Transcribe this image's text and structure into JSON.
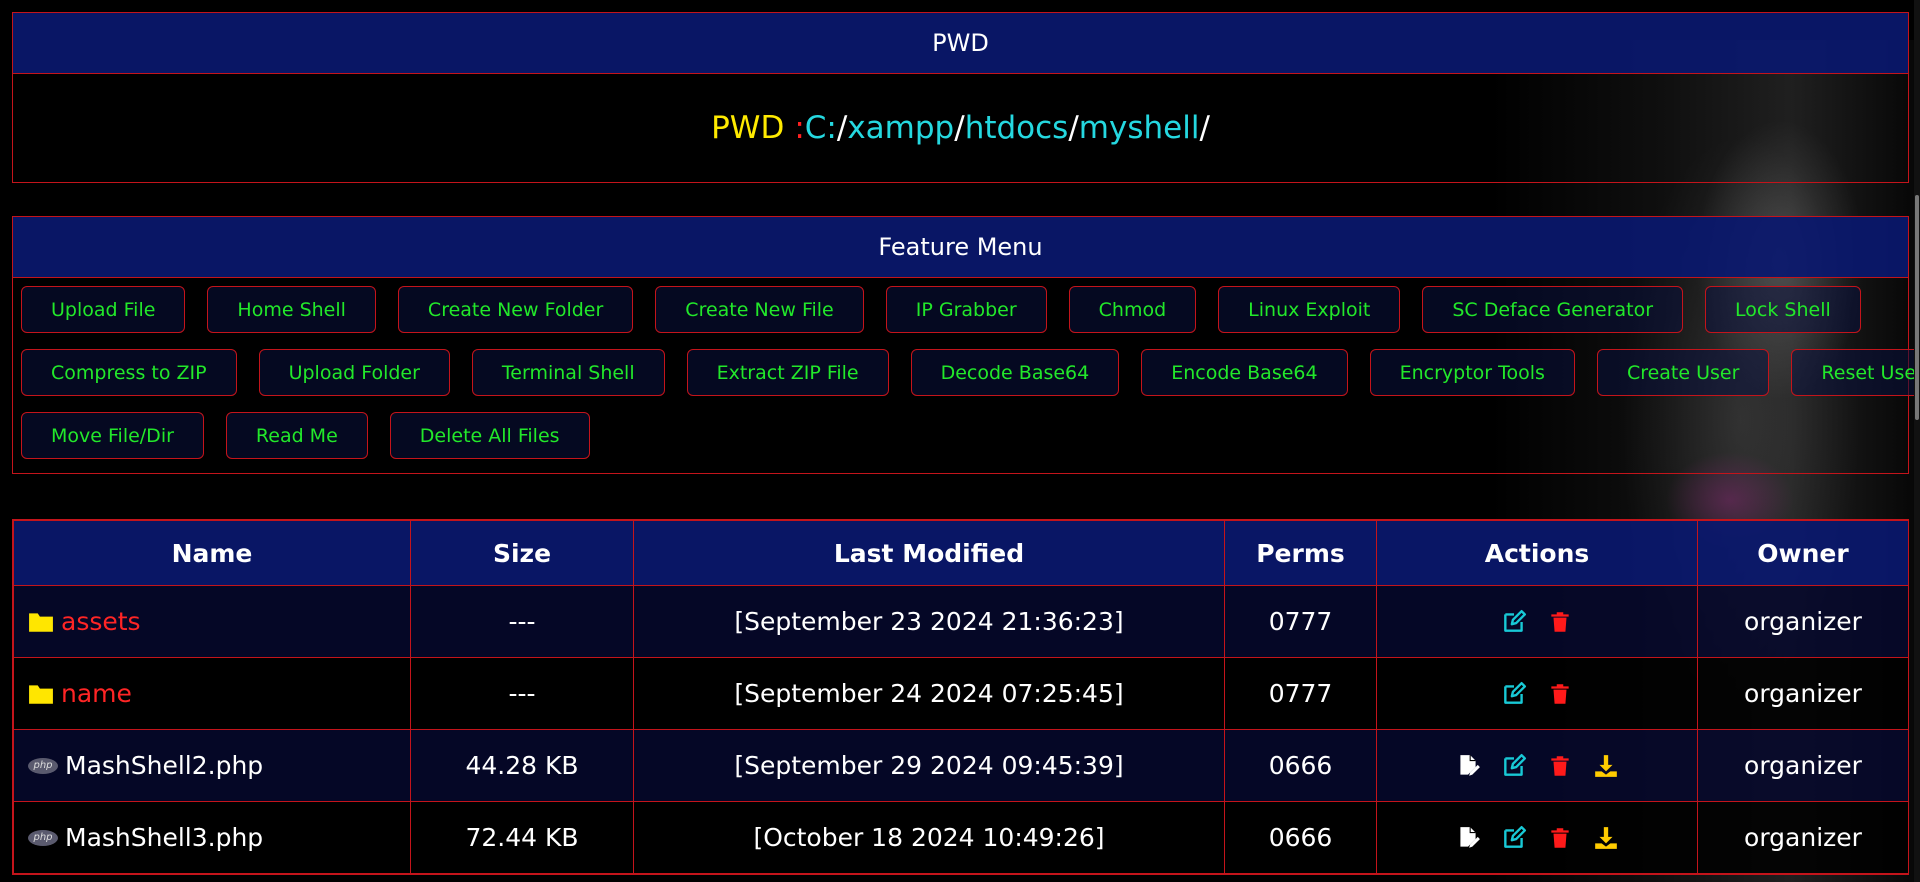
{
  "pwd_panel": {
    "title": "PWD",
    "label": "PWD",
    "colon": ":",
    "segments": [
      "C:",
      "xampp",
      "htdocs",
      "myshell"
    ],
    "separator": "/"
  },
  "feature_menu": {
    "title": "Feature Menu",
    "rows": [
      [
        "Upload File",
        "Home Shell",
        "Create New Folder",
        "Create New File",
        "IP Grabber",
        "Chmod",
        "Linux Exploit",
        "SC Deface Generator",
        "Lock Shell"
      ],
      [
        "Compress to ZIP",
        "Upload Folder",
        "Terminal Shell",
        "Extract ZIP File",
        "Decode Base64",
        "Encode Base64",
        "Encryptor Tools",
        "Create User",
        "Reset Users"
      ],
      [
        "Move File/Dir",
        "Read Me",
        "Delete All Files"
      ]
    ]
  },
  "file_table": {
    "headers": [
      "Name",
      "Size",
      "Last Modified",
      "Perms",
      "Actions",
      "Owner"
    ],
    "rows": [
      {
        "type": "folder",
        "name": "assets",
        "size": "---",
        "modified": "[September 23 2024 21:36:23]",
        "perms": "0777",
        "owner": "organizer"
      },
      {
        "type": "folder",
        "name": "name",
        "size": "---",
        "modified": "[September 24 2024 07:25:45]",
        "perms": "0777",
        "owner": "organizer"
      },
      {
        "type": "php",
        "name": "MashShell2.php",
        "size": "44.28 KB",
        "modified": "[September 29 2024 09:45:39]",
        "perms": "0666",
        "owner": "organizer"
      },
      {
        "type": "php",
        "name": "MashShell3.php",
        "size": "72.44 KB",
        "modified": "[October 18 2024 10:49:26]",
        "perms": "0666",
        "owner": "organizer"
      }
    ]
  },
  "icons": {
    "folder": "folder-icon",
    "php": "php-file-icon",
    "php_badge_text": "php",
    "edit_file": "edit-file-icon",
    "rename": "rename-icon",
    "delete": "trash-icon",
    "download": "download-icon"
  },
  "colors": {
    "header_bg": "#0a186e",
    "border": "#c4141b",
    "button_text": "#22e82a",
    "pwd_label": "#ffea00",
    "path_segment": "#25d8e0",
    "folder_name": "#ff2525",
    "folder_icon": "#ffe600",
    "edit_icon": "#18c9d6",
    "delete_icon": "#ff1a1a",
    "download_icon": "#ffcc00"
  }
}
